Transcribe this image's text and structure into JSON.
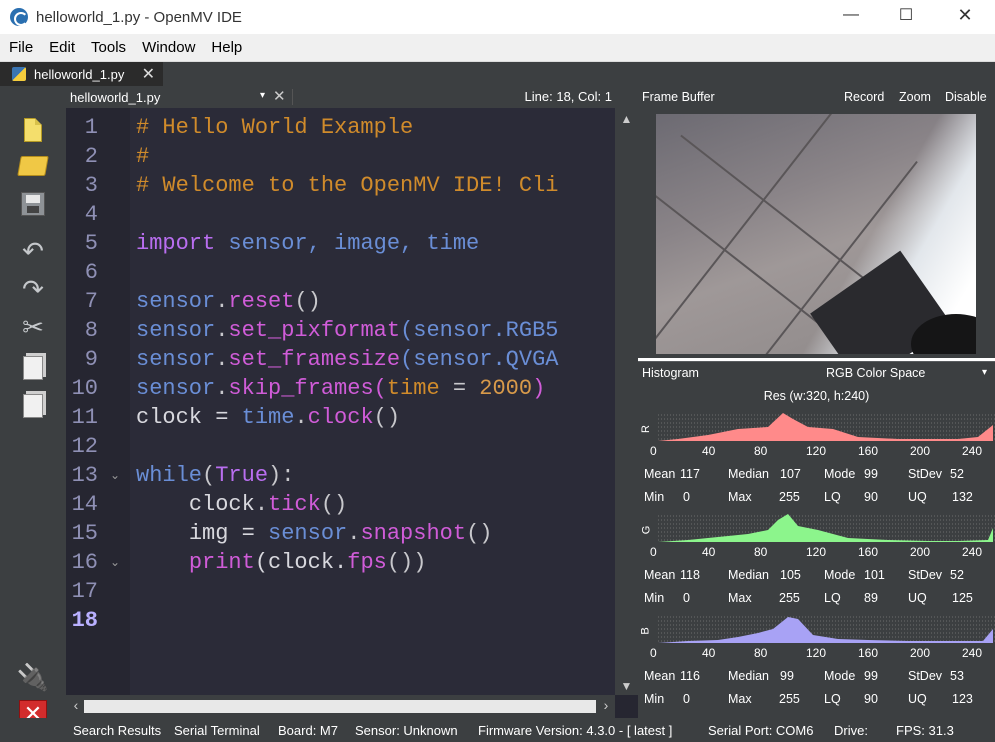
{
  "window": {
    "title": "helloworld_1.py - OpenMV IDE",
    "minimize_glyph": "—",
    "maximize_glyph": "☐",
    "close_glyph": "✕"
  },
  "menu": [
    "File",
    "Edit",
    "Tools",
    "Window",
    "Help"
  ],
  "file_tab": {
    "label": "helloworld_1.py",
    "close": "✕"
  },
  "toolbar": {
    "icons": [
      "new-file-icon",
      "open-folder-icon",
      "save-icon",
      "undo-icon",
      "redo-icon",
      "cut-icon",
      "copy-icon",
      "paste-icon",
      "connect-icon",
      "stop-icon"
    ],
    "undo_glyph": "↶",
    "redo_glyph": "↷",
    "cut_glyph": "✂",
    "connect_glyph": "🔌",
    "stop_glyph": "✕"
  },
  "editor": {
    "file_combo": "helloworld_1.py",
    "combo_arrow": "▾",
    "close_doc": "✕",
    "line_col": "Line: 18, Col: 1",
    "line_numbers": [
      "1",
      "2",
      "3",
      "4",
      "5",
      "6",
      "7",
      "8",
      "9",
      "10",
      "11",
      "12",
      "13",
      "14",
      "15",
      "16",
      "17",
      "18"
    ],
    "current_line": "18",
    "fold_glyph": "⌄",
    "code": {
      "l1": "# Hello World Example",
      "l2": "#",
      "l3": "# Welcome to the OpenMV IDE! Cli",
      "l5_kw": "import",
      "l5_rest": "sensor, image, time",
      "l7_obj": "sensor",
      "l7_fn": "reset",
      "l7_tail": "()",
      "l8_obj": "sensor",
      "l8_fn": "set_pixformat",
      "l8_arg": "(sensor.RGB5",
      "l9_obj": "sensor",
      "l9_fn": "set_framesize",
      "l9_arg": "(sensor.QVGA",
      "l10_obj": "sensor",
      "l10_fn": "skip_frames",
      "l10_p": "(",
      "l10_kw": "time",
      "l10_eq": " = ",
      "l10_num": "2000",
      "l10_close": ")",
      "l11_var": "clock = ",
      "l11_mod": "time",
      "l11_fn": "clock",
      "l11_tail": "()",
      "l13_kw": "while",
      "l13_true": "True",
      "l13_tail": "):",
      "l14_var": "clock",
      "l14_fn": "tick",
      "l14_tail": "()",
      "l15_var": "img = ",
      "l15_mod": "sensor",
      "l15_fn": "snapshot",
      "l15_tail": "()",
      "l16_fn": "print",
      "l16_var": "(clock.",
      "l16_fn2": "fps",
      "l16_tail": "())"
    }
  },
  "frame_buffer": {
    "title": "Frame Buffer",
    "actions": [
      "Record",
      "Zoom",
      "Disable"
    ]
  },
  "histogram": {
    "title": "Histogram",
    "color_space": "RGB Color Space",
    "combo_arrow": "▾",
    "resolution": "Res (w:320, h:240)",
    "ticks": [
      "0",
      "40",
      "80",
      "120",
      "160",
      "200",
      "240"
    ],
    "stat_labels": {
      "mean": "Mean",
      "median": "Median",
      "mode": "Mode",
      "stdev": "StDev",
      "min": "Min",
      "max": "Max",
      "lq": "LQ",
      "uq": "UQ"
    },
    "channels": [
      {
        "name": "R",
        "color": "#ff8a8a",
        "mean": "117",
        "median": "107",
        "mode": "99",
        "stdev": "52",
        "min": "0",
        "max": "255",
        "lq": "90",
        "uq": "132"
      },
      {
        "name": "G",
        "color": "#8cf58c",
        "mean": "118",
        "median": "105",
        "mode": "101",
        "stdev": "52",
        "min": "0",
        "max": "255",
        "lq": "89",
        "uq": "125"
      },
      {
        "name": "B",
        "color": "#a8a2f5",
        "mean": "116",
        "median": "99",
        "mode": "99",
        "stdev": "53",
        "min": "0",
        "max": "255",
        "lq": "90",
        "uq": "123"
      }
    ]
  },
  "statusbar": {
    "search_results": "Search Results",
    "serial_terminal": "Serial Terminal",
    "board": "Board: M7",
    "sensor": "Sensor: Unknown",
    "firmware": "Firmware Version: 4.3.0 - [ latest ]",
    "serial_port": "Serial Port: COM6",
    "drive": "Drive:",
    "fps": "FPS:  31.3"
  }
}
